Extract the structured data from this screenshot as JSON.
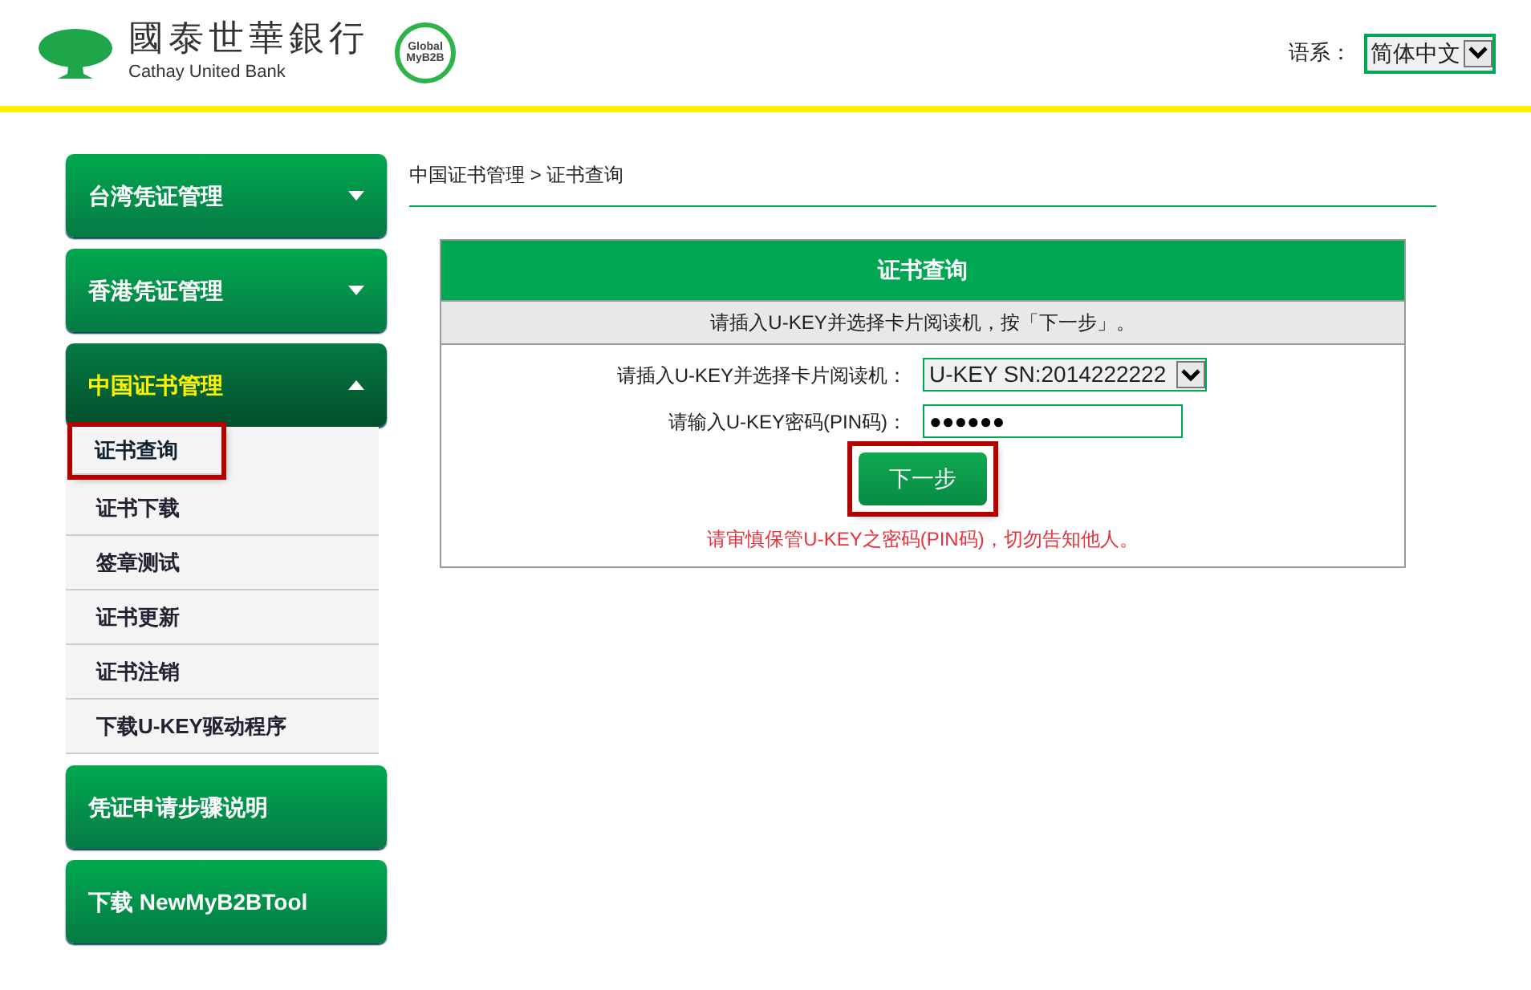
{
  "header": {
    "bank_name": "國泰世華銀行",
    "bank_name_en": "Cathay United Bank",
    "badge_lines": [
      "Global",
      "MyB2B"
    ],
    "language_label": "语系：",
    "language_value": "简体中文"
  },
  "sidebar": {
    "groups": [
      {
        "label": "台湾凭证管理",
        "expandable": true,
        "expanded": false
      },
      {
        "label": "香港凭证管理",
        "expandable": true,
        "expanded": false
      },
      {
        "label": "中国证书管理",
        "expandable": true,
        "expanded": true,
        "children": [
          {
            "label": "证书查询",
            "selected": true,
            "highlighted": true
          },
          {
            "label": "证书下载",
            "selected": false,
            "highlighted": false
          },
          {
            "label": "签章测试",
            "selected": false,
            "highlighted": false
          },
          {
            "label": "证书更新",
            "selected": false,
            "highlighted": false
          },
          {
            "label": "证书注销",
            "selected": false,
            "highlighted": false
          },
          {
            "label": "下载U-KEY驱动程序",
            "selected": false,
            "highlighted": false
          }
        ]
      },
      {
        "label": "凭证申请步骤说明",
        "expandable": false,
        "expanded": false
      },
      {
        "label": "下载 NewMyB2BTool",
        "expandable": false,
        "expanded": false
      }
    ]
  },
  "breadcrumb": "中国证书管理 > 证书查询",
  "panel": {
    "title": "证书查询",
    "instruction": "请插入U-KEY并选择卡片阅读机，按「下一步」。",
    "fields": [
      {
        "kind": "select",
        "label": "请插入U-KEY并选择卡片阅读机：",
        "value": "U-KEY SN:2014222222"
      },
      {
        "kind": "password",
        "label": "请输入U-KEY密码(PIN码)：",
        "value": "●●●●●●"
      }
    ],
    "button": {
      "label": "下一步",
      "highlighted": true
    },
    "warning": "请审慎保管U-KEY之密码(PIN码)，切勿告知他人。"
  }
}
